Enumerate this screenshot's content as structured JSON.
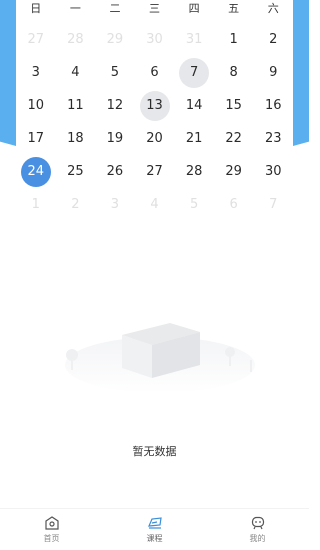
{
  "calendar": {
    "weekdays": [
      "日",
      "一",
      "二",
      "三",
      "四",
      "五",
      "六"
    ],
    "weeks": [
      [
        {
          "d": "27",
          "f": true
        },
        {
          "d": "28",
          "f": true
        },
        {
          "d": "29",
          "f": true
        },
        {
          "d": "30",
          "f": true
        },
        {
          "d": "31",
          "f": true
        },
        {
          "d": "1"
        },
        {
          "d": "2"
        }
      ],
      [
        {
          "d": "3"
        },
        {
          "d": "4"
        },
        {
          "d": "5"
        },
        {
          "d": "6"
        },
        {
          "d": "7",
          "m": true
        },
        {
          "d": "8"
        },
        {
          "d": "9"
        }
      ],
      [
        {
          "d": "10"
        },
        {
          "d": "11"
        },
        {
          "d": "12"
        },
        {
          "d": "13",
          "m": true
        },
        {
          "d": "14"
        },
        {
          "d": "15"
        },
        {
          "d": "16"
        }
      ],
      [
        {
          "d": "17"
        },
        {
          "d": "18"
        },
        {
          "d": "19"
        },
        {
          "d": "20"
        },
        {
          "d": "21"
        },
        {
          "d": "22"
        },
        {
          "d": "23"
        }
      ],
      [
        {
          "d": "24",
          "t": true
        },
        {
          "d": "25"
        },
        {
          "d": "26"
        },
        {
          "d": "27"
        },
        {
          "d": "28"
        },
        {
          "d": "29"
        },
        {
          "d": "30"
        }
      ],
      [
        {
          "d": "1",
          "f": true
        },
        {
          "d": "2",
          "f": true
        },
        {
          "d": "3",
          "f": true
        },
        {
          "d": "4",
          "f": true
        },
        {
          "d": "5",
          "f": true
        },
        {
          "d": "6",
          "f": true
        },
        {
          "d": "7",
          "f": true
        }
      ]
    ]
  },
  "empty_state": {
    "text": "暂无数据"
  },
  "nav": {
    "items": [
      {
        "label": "首页",
        "icon": "home-icon"
      },
      {
        "label": "课程",
        "icon": "course-icon"
      },
      {
        "label": "我的",
        "icon": "profile-icon"
      }
    ]
  },
  "colors": {
    "accent": "#5ab0ef",
    "today": "#4a90e2",
    "marked": "#e6e7ea"
  }
}
